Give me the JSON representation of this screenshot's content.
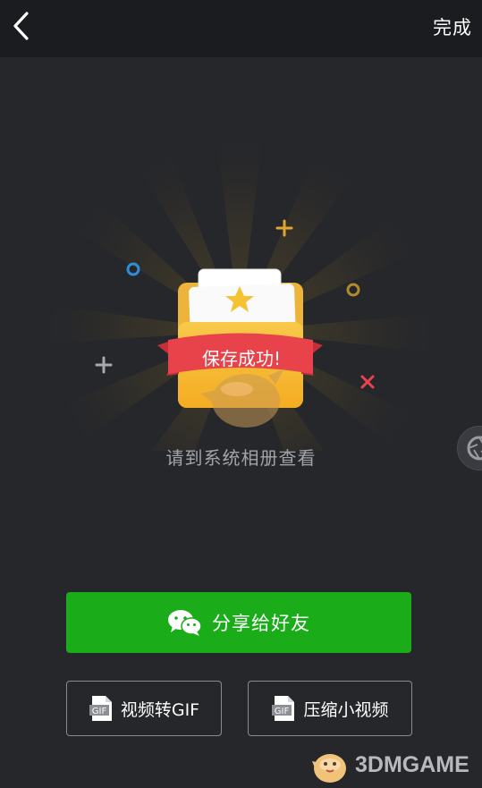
{
  "header": {
    "done_label": "完成"
  },
  "success": {
    "banner_text": "保存成功!",
    "message": "请到系统相册查看"
  },
  "actions": {
    "share_label": "分享给好友",
    "gif_label": "视频转GIF",
    "compress_label": "压缩小视频",
    "gif_icon_text": "GIF"
  },
  "watermark": {
    "text": "3DMGAME"
  },
  "colors": {
    "background": "#26272b",
    "share_green": "#1aad19",
    "banner_red": "#e8434b",
    "envelope_yellow": "#f6c232"
  },
  "icons": [
    "back-arrow-icon",
    "star-icon",
    "wechat-icon",
    "gif-file-icon",
    "camera-shutter-icon"
  ]
}
